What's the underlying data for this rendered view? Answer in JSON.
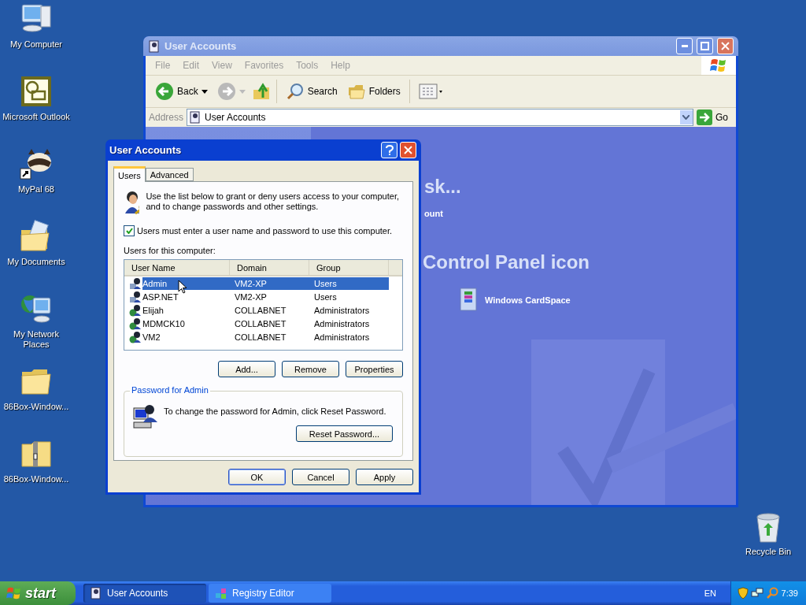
{
  "desktop_icons": [
    {
      "label": "My Computer",
      "kind": "computer"
    },
    {
      "label": "Microsoft Outlook",
      "kind": "outlook"
    },
    {
      "label": "MyPal 68",
      "kind": "raccoon"
    },
    {
      "label": "My Documents",
      "kind": "documents"
    },
    {
      "label": "My Network Places",
      "kind": "network"
    },
    {
      "label": "86Box-Window...",
      "kind": "folder"
    },
    {
      "label": "86Box-Window...",
      "kind": "zip"
    }
  ],
  "recycle_bin": {
    "label": "Recycle Bin"
  },
  "explorer": {
    "title": "User Accounts",
    "menu": [
      "File",
      "Edit",
      "View",
      "Favorites",
      "Tools",
      "Help"
    ],
    "toolbar": {
      "back": "Back",
      "search": "Search",
      "folders": "Folders"
    },
    "address": {
      "label": "Address",
      "value": "User Accounts",
      "go": "Go"
    },
    "content": {
      "heading_fragment": "sk...",
      "link_fragment": "ount",
      "section_heading": "Control Panel icon",
      "item": "Windows CardSpace"
    }
  },
  "dialog": {
    "title": "User Accounts",
    "tabs": [
      {
        "label": "Users",
        "selected": true
      },
      {
        "label": "Advanced",
        "selected": false
      }
    ],
    "intro": "Use the list below to grant or deny users access to your computer, and to change passwords and other settings.",
    "checkbox": {
      "label": "Users must enter a user name and password to use this computer.",
      "checked": true
    },
    "list_label": "Users for this computer:",
    "columns": [
      "User Name",
      "Domain",
      "Group"
    ],
    "rows": [
      {
        "user_name": "Admin",
        "domain": "VM2-XP",
        "group": "Users",
        "kind": "local",
        "selected": true
      },
      {
        "user_name": "ASP.NET",
        "domain": "VM2-XP",
        "group": "Users",
        "kind": "local",
        "selected": false
      },
      {
        "user_name": "Elijah",
        "domain": "COLLABNET",
        "group": "Administrators",
        "kind": "domain",
        "selected": false
      },
      {
        "user_name": "MDMCK10",
        "domain": "COLLABNET",
        "group": "Administrators",
        "kind": "domain",
        "selected": false
      },
      {
        "user_name": "VM2",
        "domain": "COLLABNET",
        "group": "Administrators",
        "kind": "domain",
        "selected": false
      }
    ],
    "list_buttons": [
      "Add...",
      "Remove",
      "Properties"
    ],
    "password_group": {
      "title": "Password for Admin",
      "text": "To change the password for Admin, click Reset Password.",
      "button": "Reset Password..."
    },
    "footer_buttons": [
      {
        "label": "OK",
        "default": true
      },
      {
        "label": "Cancel",
        "default": false
      },
      {
        "label": "Apply",
        "default": false
      }
    ]
  },
  "taskbar": {
    "start": "start",
    "tasks": [
      {
        "label": "User Accounts",
        "selected": true,
        "kind": "accounts"
      },
      {
        "label": "Registry Editor",
        "selected": false,
        "kind": "registry"
      }
    ],
    "language": "EN",
    "clock": "7:39"
  }
}
